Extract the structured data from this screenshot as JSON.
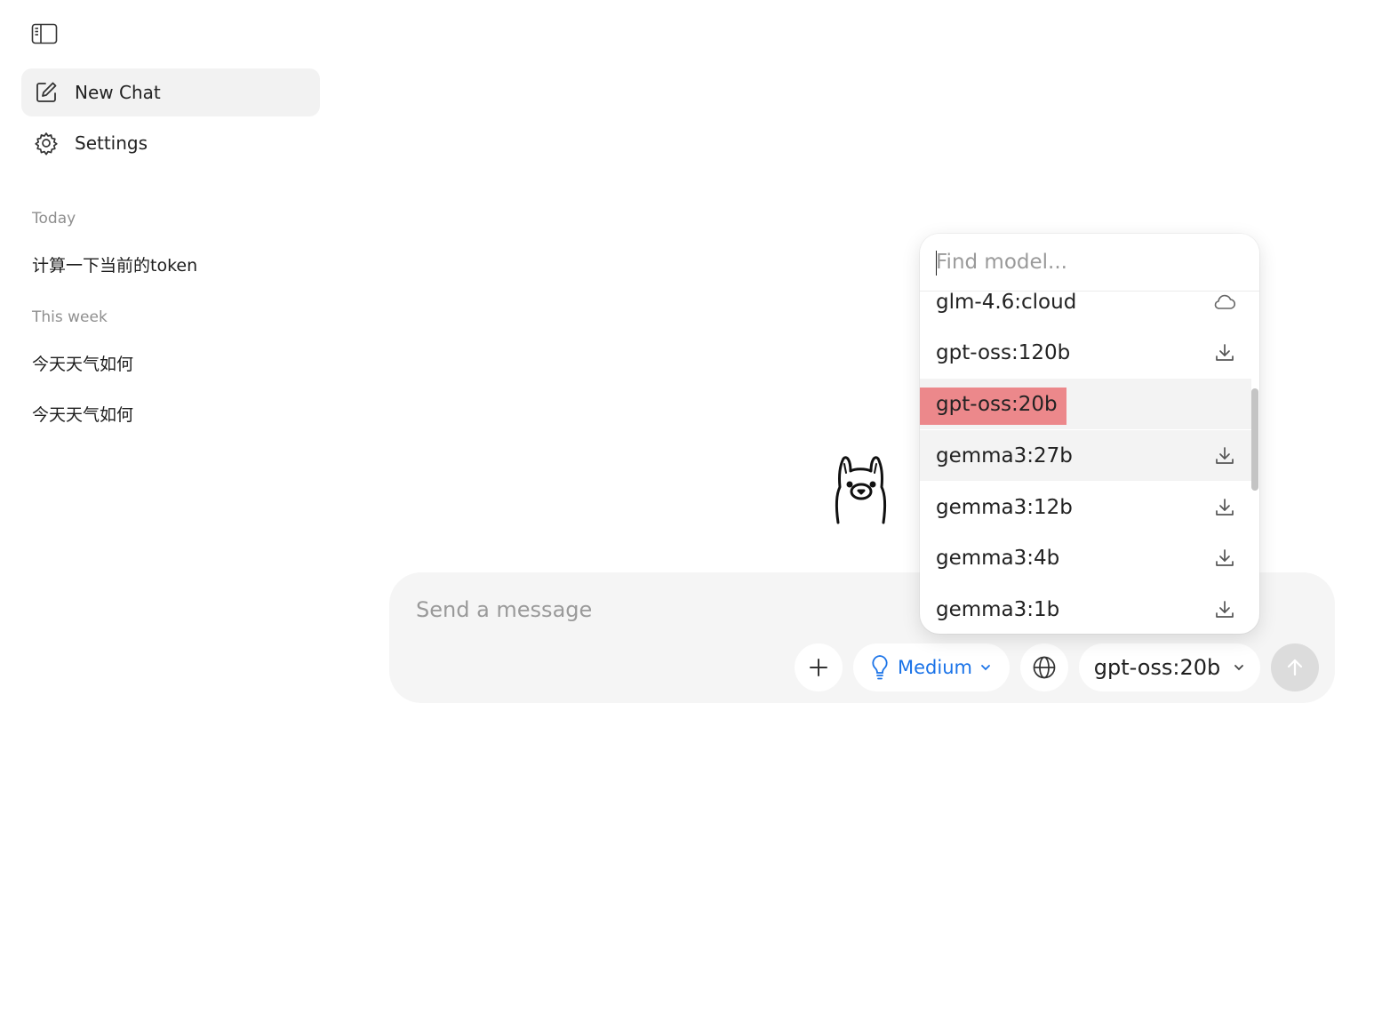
{
  "sidebar": {
    "toggle_icon": "sidebar-panel-icon",
    "nav": [
      {
        "label": "New Chat",
        "icon": "edit-icon",
        "active": true
      },
      {
        "label": "Settings",
        "icon": "gear-icon",
        "active": false
      }
    ],
    "sections": [
      {
        "label": "Today",
        "items": [
          "计算一下当前的token"
        ]
      },
      {
        "label": "This week",
        "items": [
          "今天天气如何",
          "今天天气如何"
        ]
      }
    ]
  },
  "composer": {
    "placeholder": "Send a message",
    "add_icon": "plus-icon",
    "effort_label": "Medium",
    "effort_icon": "lightbulb-icon",
    "web_icon": "globe-icon",
    "model_label": "gpt-oss:20b",
    "send_icon": "arrow-up-icon"
  },
  "model_menu": {
    "search_placeholder": "Find model...",
    "models": [
      {
        "name": "glm-4.6:cloud",
        "icon": "cloud-icon"
      },
      {
        "name": "gpt-oss:120b",
        "icon": "download-icon"
      },
      {
        "name": "gpt-oss:20b",
        "icon": "",
        "selected": true
      },
      {
        "name": "gemma3:27b",
        "icon": "download-icon",
        "hovered": true
      },
      {
        "name": "gemma3:12b",
        "icon": "download-icon"
      },
      {
        "name": "gemma3:4b",
        "icon": "download-icon"
      },
      {
        "name": "gemma3:1b",
        "icon": "download-icon"
      }
    ]
  },
  "colors": {
    "accent": "#1a73e8",
    "selected_highlight": "#ec888b",
    "composer_bg": "#f5f5f5"
  }
}
